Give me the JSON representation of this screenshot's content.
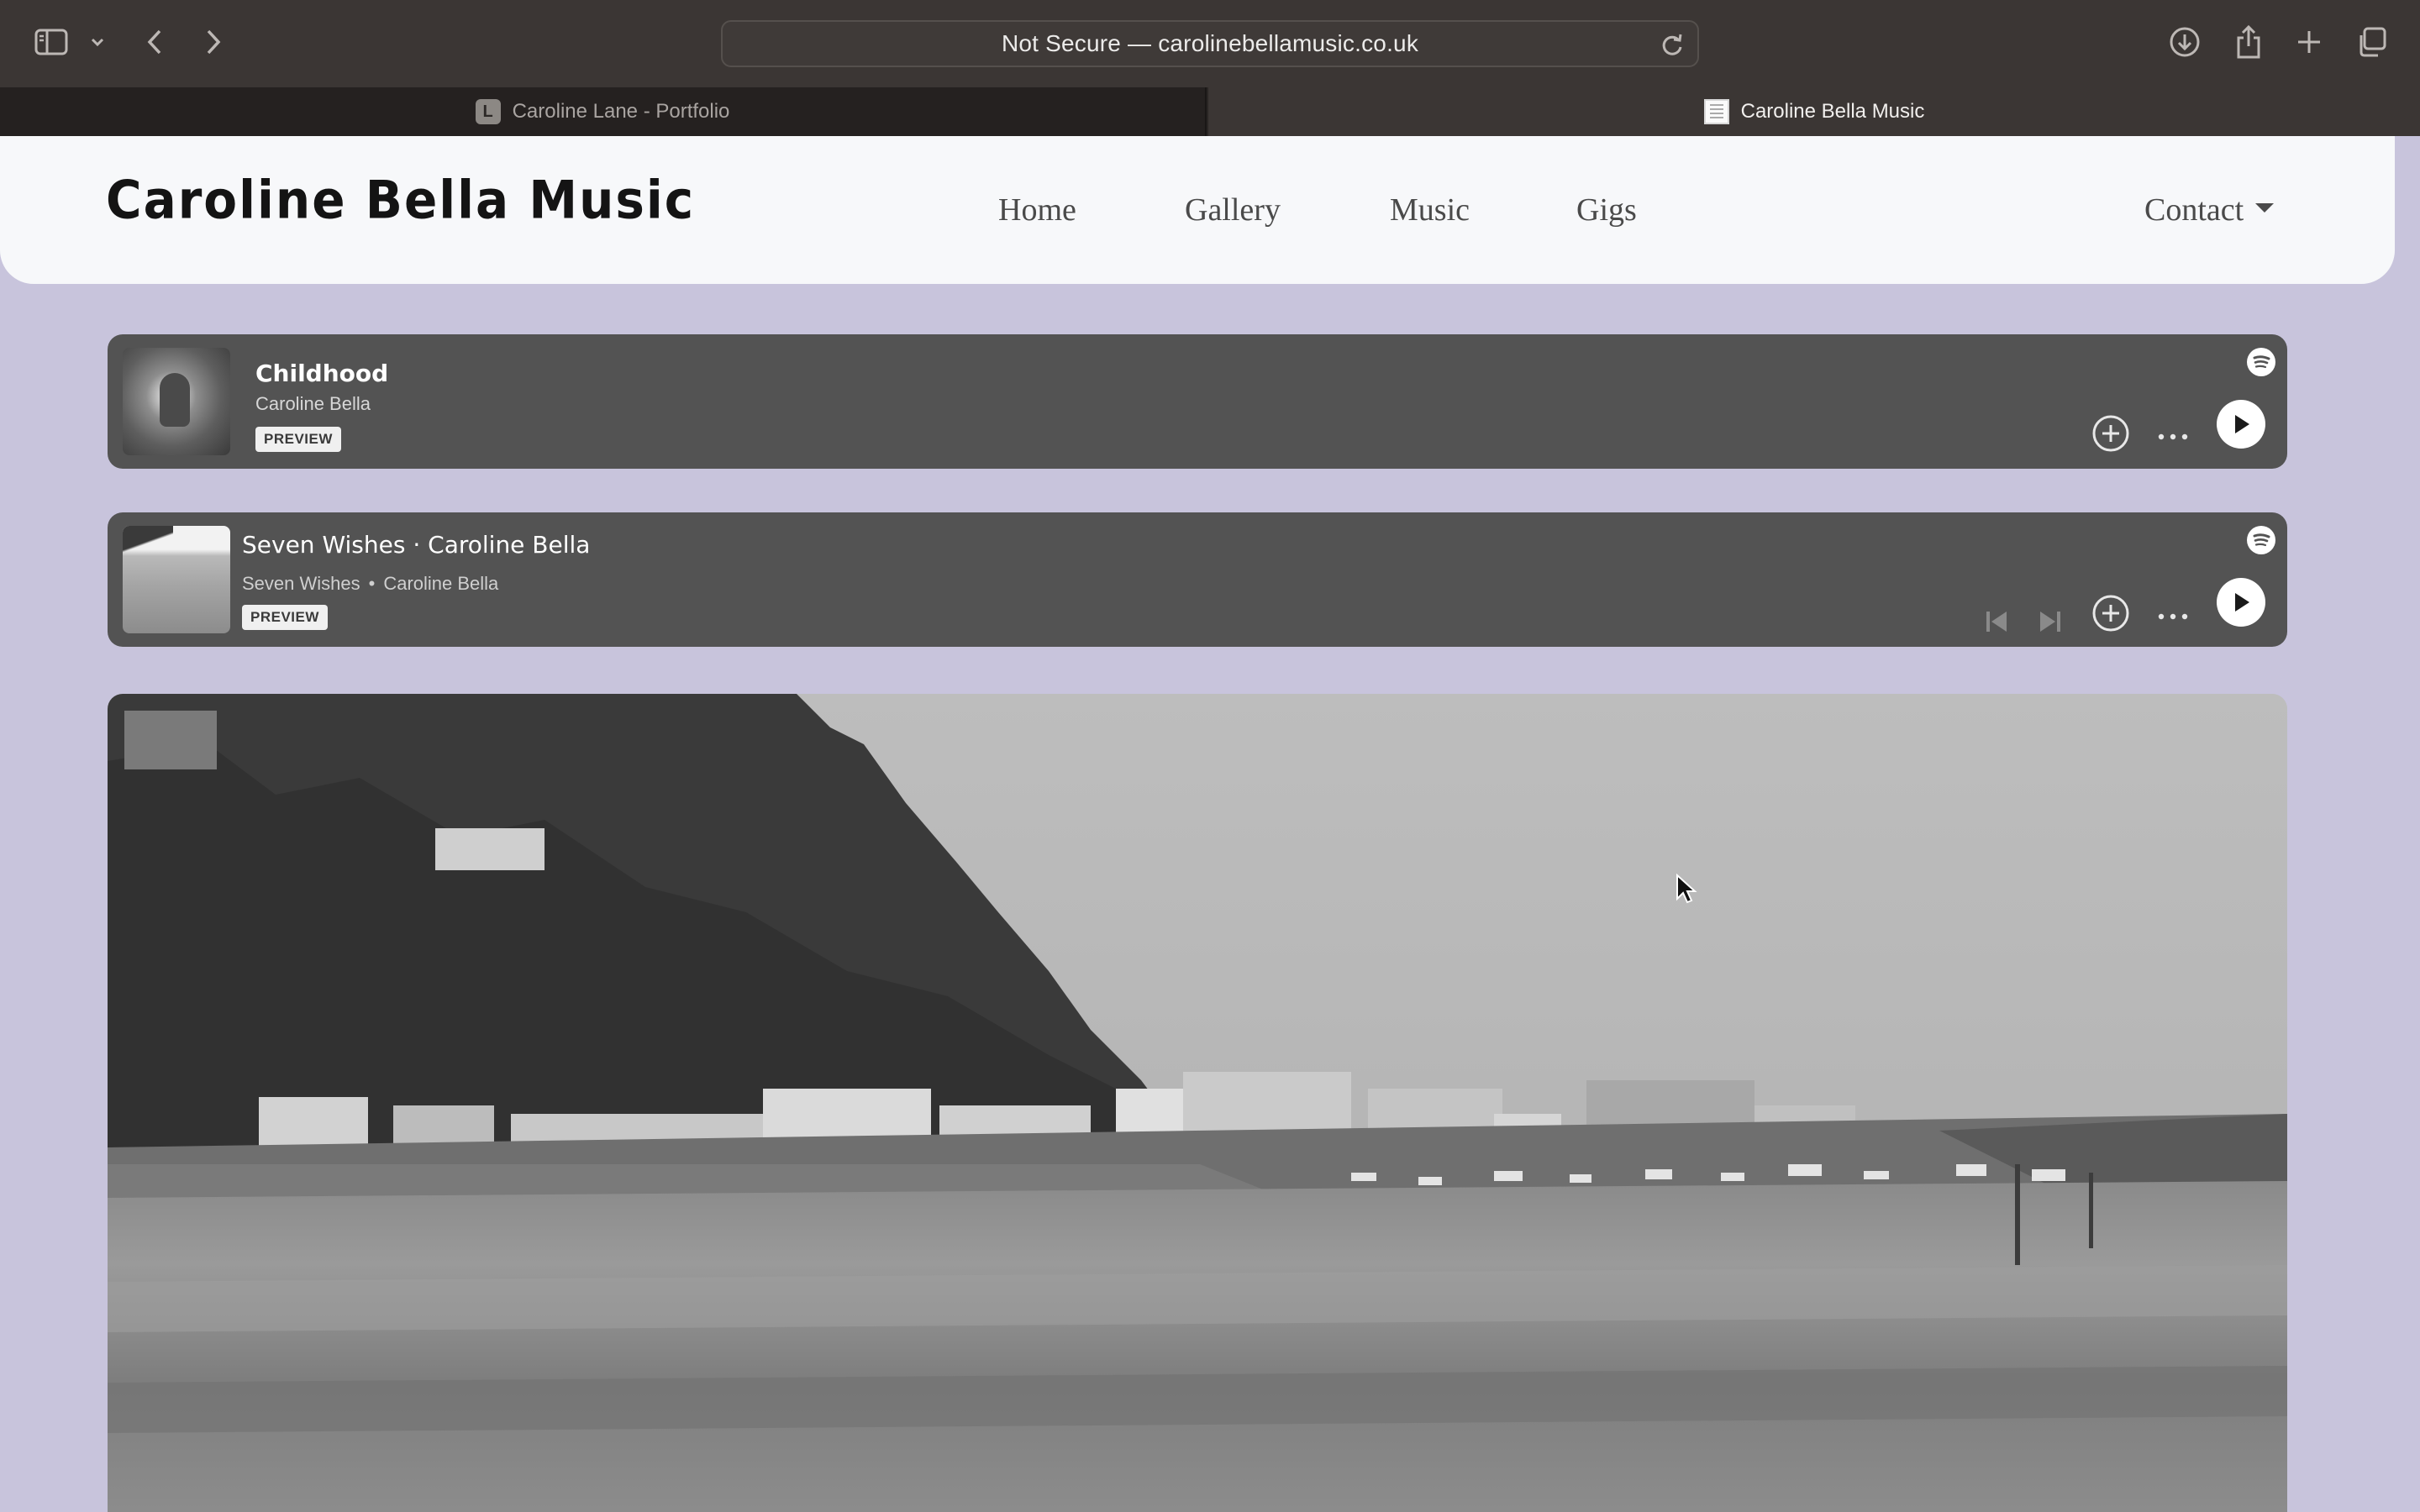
{
  "browser": {
    "url_text": "Not Secure — carolinebellamusic.co.uk",
    "tabs": [
      {
        "label": "Caroline Lane - Portfolio",
        "favicon_letter": "L",
        "active": false
      },
      {
        "label": "Caroline Bella Music",
        "active": true
      }
    ],
    "toolbar_icons": [
      "sidebar-icon",
      "chevron-down-icon",
      "back-icon",
      "forward-icon",
      "reload-icon",
      "download-icon",
      "share-icon",
      "new-tab-icon",
      "tab-overview-icon"
    ]
  },
  "site": {
    "title": "Caroline Bella Music",
    "nav": {
      "home": "Home",
      "gallery": "Gallery",
      "music": "Music",
      "gigs": "Gigs",
      "contact": "Contact"
    }
  },
  "players": [
    {
      "title": "Childhood",
      "artist": "Caroline Bella",
      "badge": "PREVIEW",
      "controls": [
        "add-icon",
        "more-icon",
        "play-icon"
      ]
    },
    {
      "title": "Seven Wishes · Caroline Bella",
      "album": "Seven Wishes",
      "separator": "•",
      "artist": "Caroline Bella",
      "badge": "PREVIEW",
      "controls": [
        "skip-back-icon",
        "skip-forward-icon",
        "add-icon",
        "more-icon",
        "play-icon"
      ]
    }
  ],
  "hero": {
    "subject": "black-and-white harbour photograph"
  },
  "colors": {
    "page_background": "#c8c4dc",
    "header_background": "#f7f8fa",
    "player_background": "#535353",
    "browser_chrome": "#3b3634"
  }
}
